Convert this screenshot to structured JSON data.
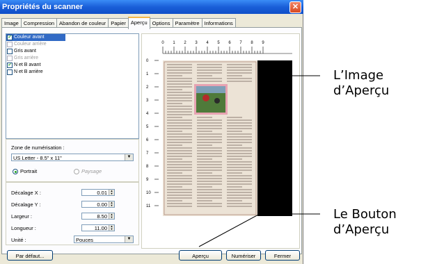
{
  "window": {
    "title": "Propriétés du scanner",
    "close_glyph": "✕"
  },
  "tabs": [
    {
      "label": "Image"
    },
    {
      "label": "Compression"
    },
    {
      "label": "Abandon de couleur"
    },
    {
      "label": "Papier"
    },
    {
      "label": "Aperçu",
      "active": true
    },
    {
      "label": "Options"
    },
    {
      "label": "Paramètre"
    },
    {
      "label": "Informations"
    }
  ],
  "image_list": [
    {
      "label": "Couleur avant",
      "checked": true,
      "selected": true,
      "enabled": true
    },
    {
      "label": "Couleur arrière",
      "checked": false,
      "selected": false,
      "enabled": false
    },
    {
      "label": "Gris avant",
      "checked": false,
      "selected": false,
      "enabled": true
    },
    {
      "label": "Gris arrière",
      "checked": false,
      "selected": false,
      "enabled": false
    },
    {
      "label": "N et B avant",
      "checked": true,
      "selected": false,
      "enabled": true
    },
    {
      "label": "N et B arrière",
      "checked": false,
      "selected": false,
      "enabled": true
    }
  ],
  "scan_area": {
    "label": "Zone de numérisation :",
    "value": "US Letter - 8.5\" x 11\"",
    "portrait_label": "Portrait",
    "landscape_label": "Paysage",
    "orientation": "portrait"
  },
  "fields": {
    "offset_x": {
      "label": "Décalage X :",
      "value": "0.01"
    },
    "offset_y": {
      "label": "Décalage Y :",
      "value": "0.00"
    },
    "width": {
      "label": "Largeur :",
      "value": "8.50"
    },
    "length": {
      "label": "Longueur :",
      "value": "11.00"
    },
    "unit": {
      "label": "Unité :",
      "value": "Pouces"
    }
  },
  "ruler": {
    "top": [
      "0",
      "1",
      "2",
      "3",
      "4",
      "5",
      "6",
      "7",
      "8",
      "9"
    ],
    "left": [
      "0",
      "1",
      "2",
      "3",
      "4",
      "5",
      "6",
      "7",
      "8",
      "9",
      "10",
      "11"
    ]
  },
  "buttons": {
    "default": "Par défaut...",
    "preview": "Aperçu",
    "scan": "Numériser",
    "close": "Fermer"
  },
  "callouts": {
    "preview_image_line1": "L’Image",
    "preview_image_line2": "d’Aperçu",
    "preview_button_line1": "Le Bouton",
    "preview_button_line2": "d’Aperçu"
  },
  "colors": {
    "titlebar": "#1a5fd8",
    "selection": "#316ac5",
    "preview_bg": "#000000"
  }
}
